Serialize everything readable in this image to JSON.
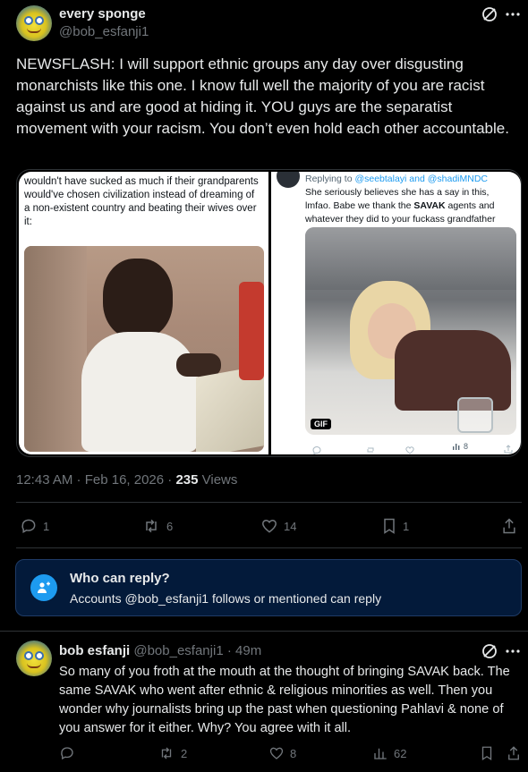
{
  "post": {
    "author_name": "every sponge",
    "author_handle": "@bob_esfanji1",
    "text": "NEWSFLASH: I will support ethnic groups any day over disgusting monarchists like this one. I know full well the majority of you are racist against us and are good at hiding it. YOU guys are the separatist movement with your racism. You don’t even hold each other accountable.",
    "timestamp": "12:43 AM · Feb 16, 2026 · ",
    "views_count": "235",
    "views_label": " Views",
    "actions": {
      "replies": "1",
      "reposts": "6",
      "likes": "14",
      "bookmarks": "1"
    }
  },
  "media": {
    "left": {
      "text": "wouldn't have sucked as much if their grandparents would've chosen civilization instead of dreaming of a non-existent country and beating their wives over it:"
    },
    "right": {
      "replying_prefix": "Replying to ",
      "replying_handles": "@seebtalayi and @shadiMNDC",
      "text_part1": "She seriously believes she has a say in this, lmfao. Babe we thank the ",
      "text_bold": "SAVAK",
      "text_part2": " agents and whatever they did to your fuckass grandfather",
      "gif_badge": "GIF",
      "views": "8"
    }
  },
  "reply_restriction": {
    "title": "Who can reply?",
    "subtitle": "Accounts @bob_esfanji1 follows or mentioned can reply"
  },
  "reply": {
    "author_name": "bob esfanji",
    "author_handle": "@bob_esfanji1",
    "time": "· 49m",
    "text": "So many of you froth at the mouth at the thought of bringing SAVAK back. The same SAVAK who went after ethnic & religious minorities as well. Then you wonder why journalists bring up the past when questioning Pahlavi & none of you answer for it either. Why? You agree with it all.",
    "actions": {
      "replies": "",
      "reposts": "2",
      "likes": "8",
      "views": "62"
    }
  },
  "colors": {
    "background": "#000000",
    "text": "#e7e9ea",
    "muted": "#71767b",
    "accent": "#1d9bf0",
    "restriction_bg": "#031a3a",
    "restriction_border": "#1f3b66"
  }
}
